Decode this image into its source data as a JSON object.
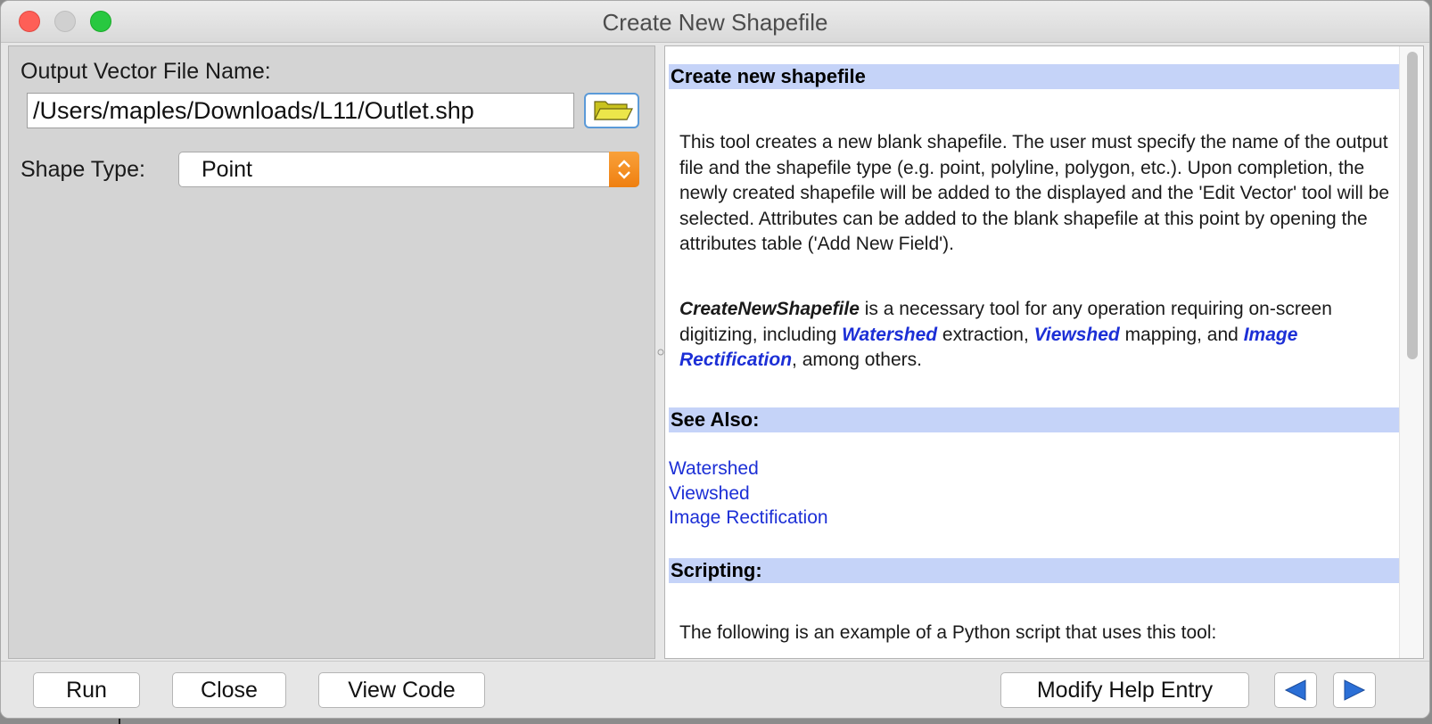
{
  "window": {
    "title": "Create New Shapefile"
  },
  "left": {
    "output_label": "Output Vector File Name:",
    "output_value": "/Users/maples/Downloads/L11/Outlet.shp",
    "browse_icon": "folder-open-icon",
    "shape_type_label": "Shape Type:",
    "shape_type_value": "Point"
  },
  "help": {
    "heading": "Create new shapefile",
    "intro": "This tool creates a new blank shapefile. The user must specify the name of the output file and the shapefile type (e.g. point, polyline, polygon, etc.). Upon completion, the newly created shapefile will be added to the displayed and the 'Edit Vector' tool will be selected. Attributes can be added to the blank shapefile at this point by opening the attributes table ('Add New Field').",
    "para2": {
      "tool_name": "CreateNewShapefile",
      "t1": " is a necessary tool for any operation requiring on-screen digitizing, including ",
      "link1": "Watershed",
      "t2": " extraction, ",
      "link2": "Viewshed",
      "t3": " mapping, and ",
      "link3": "Image Rectification",
      "t4": ", among others."
    },
    "see_also_heading": "See Also:",
    "see_also_links": [
      "Watershed",
      "Viewshed",
      "Image Rectification"
    ],
    "scripting_heading": "Scripting:",
    "scripting_text": "The following is an example of a Python script that uses this tool:"
  },
  "buttons": {
    "run": "Run",
    "close": "Close",
    "view_code": "View Code",
    "modify_help": "Modify Help Entry",
    "back_icon": "arrow-left-icon",
    "forward_icon": "arrow-right-icon"
  },
  "colors": {
    "heading_bar": "#c5d3f8",
    "link_blue": "#1c2fd6",
    "select_accent": "#f38a1e",
    "nav_arrow_blue": "#2b6fd6"
  }
}
